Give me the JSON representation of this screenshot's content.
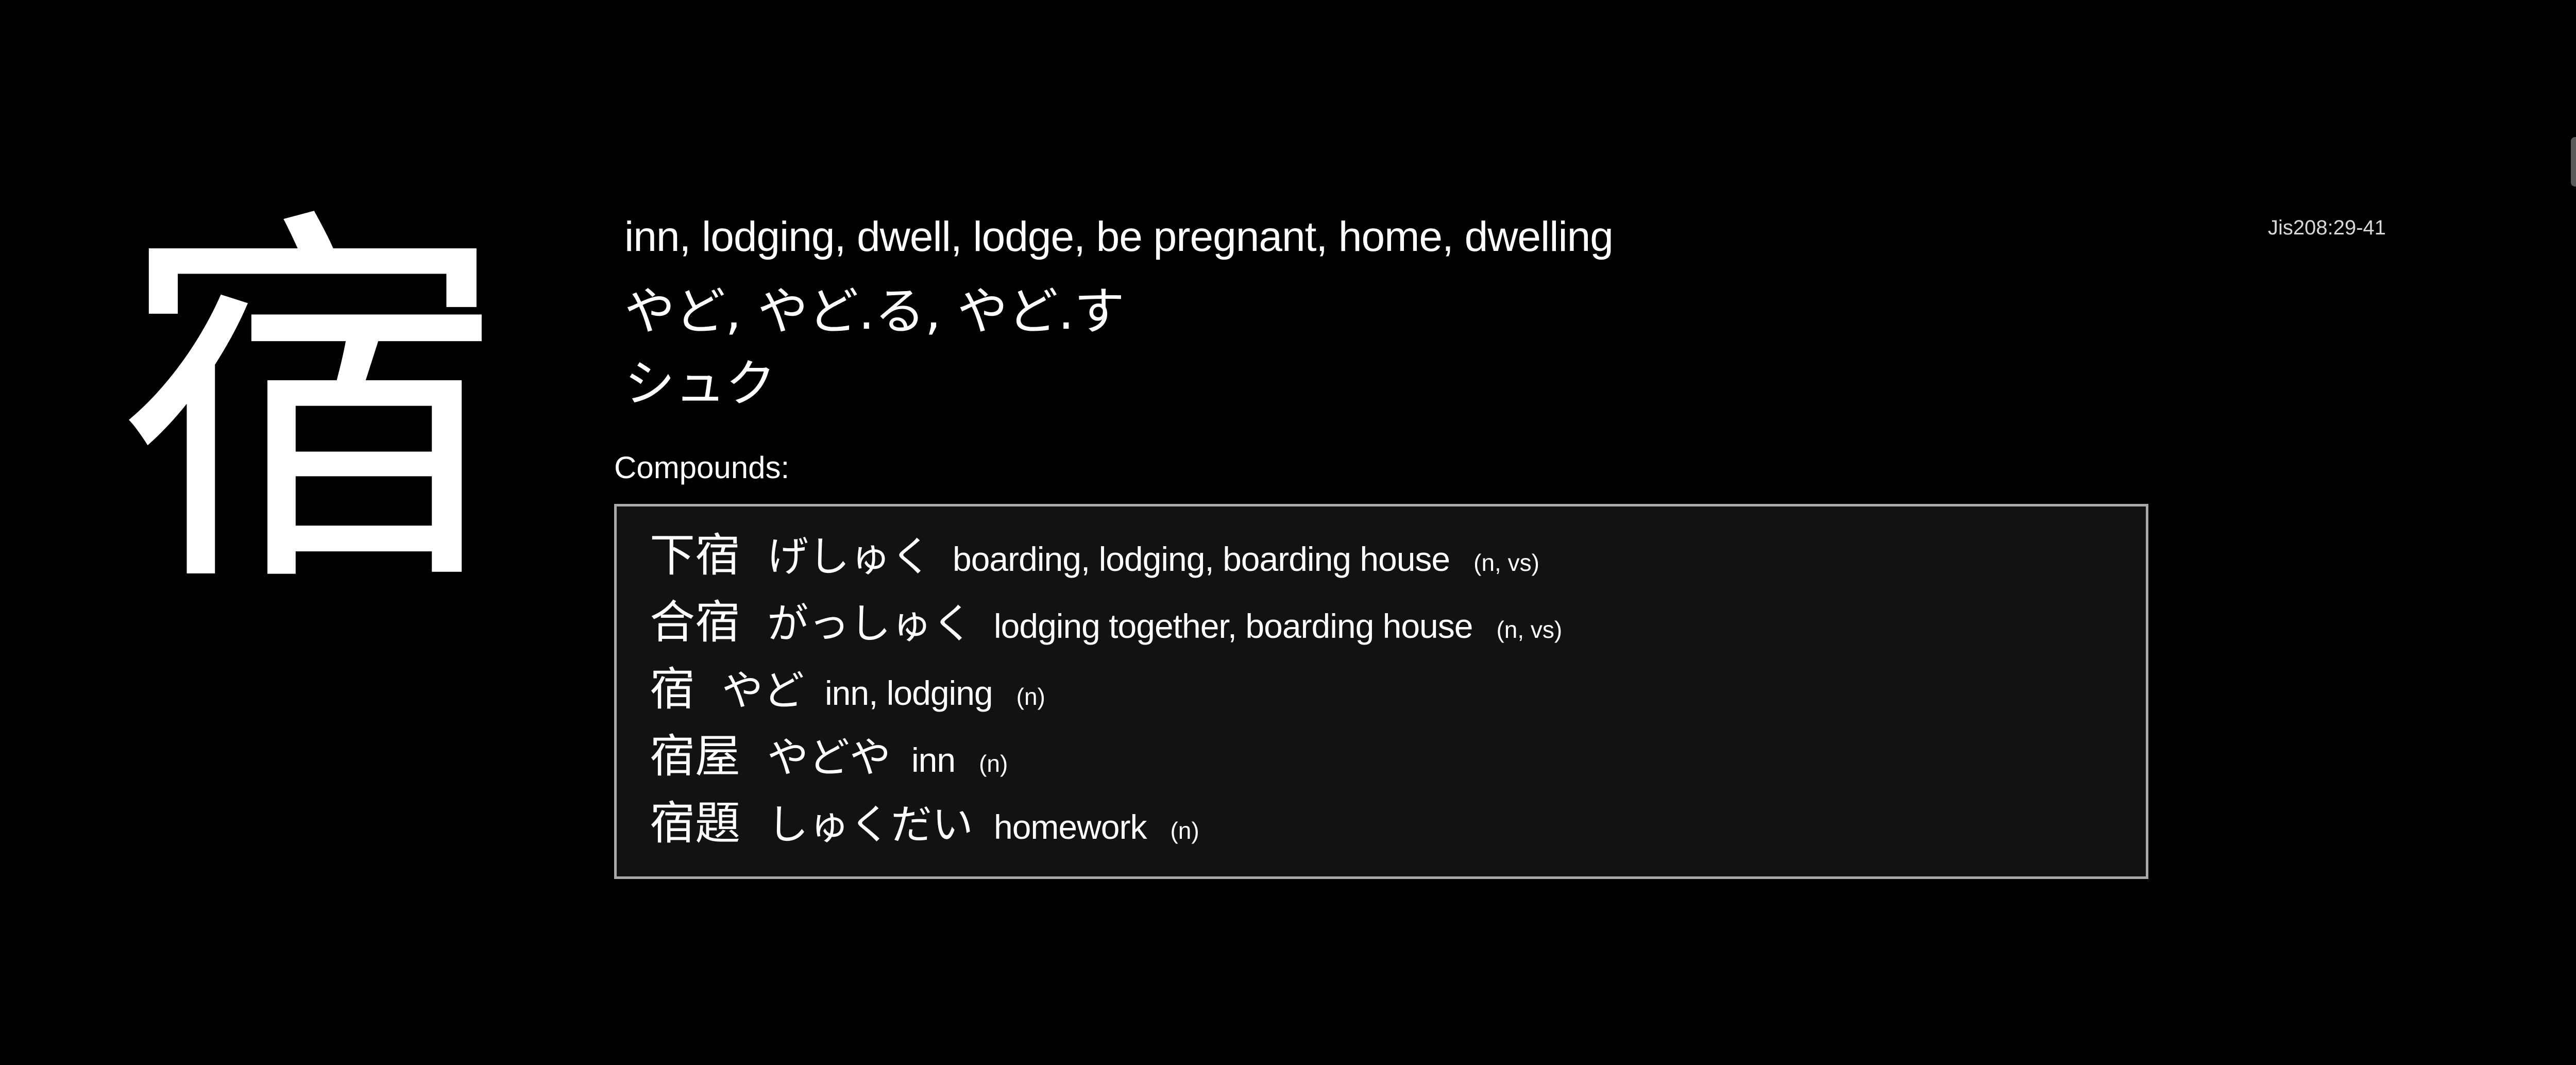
{
  "kanji": {
    "character": "宿",
    "jis_code": "Jis208:29-41",
    "meanings": "inn, lodging, dwell, lodge, be pregnant, home, dwelling",
    "kun_readings": "やど, やど.る, やど.す",
    "on_readings": "シュク"
  },
  "compounds": {
    "label": "Compounds:",
    "items": [
      {
        "word": "下宿",
        "reading": "げしゅく",
        "meaning": "boarding, lodging, boarding house",
        "pos": "(n, vs)"
      },
      {
        "word": "合宿",
        "reading": "がっしゅく",
        "meaning": "lodging together, boarding house",
        "pos": "(n, vs)"
      },
      {
        "word": "宿",
        "reading": "やど",
        "meaning": "inn, lodging",
        "pos": "(n)"
      },
      {
        "word": "宿屋",
        "reading": "やどや",
        "meaning": "inn",
        "pos": "(n)"
      },
      {
        "word": "宿題",
        "reading": "しゅくだい",
        "meaning": "homework",
        "pos": "(n)"
      }
    ]
  },
  "colors": {
    "background": "#000000",
    "text": "#ffffff",
    "box_background": "#121212",
    "box_border": "#a9a9a9"
  }
}
